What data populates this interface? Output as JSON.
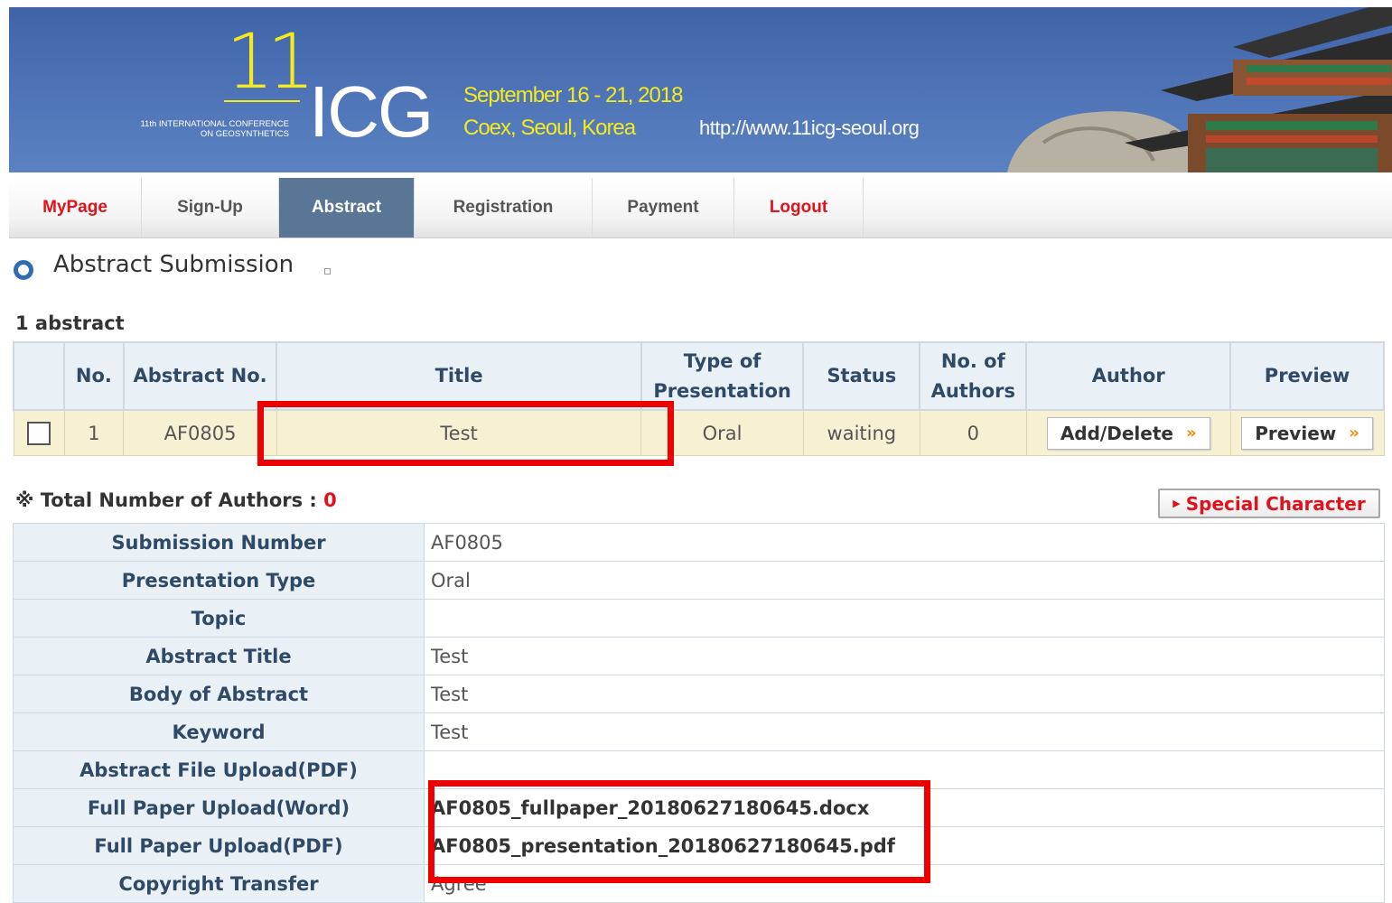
{
  "header": {
    "logo_number": "11",
    "logo_subtitle_line1": "11th INTERNATIONAL CONFERENCE",
    "logo_subtitle_line2": "ON GEOSYNTHETICS",
    "logo_acronym": "ICG",
    "event_date": "September 16 - 21, 2018",
    "event_venue": "Coex, Seoul, Korea",
    "event_url": "http://www.11icg-seoul.org"
  },
  "nav": {
    "items": [
      {
        "label": "MyPage"
      },
      {
        "label": "Sign-Up"
      },
      {
        "label": "Abstract"
      },
      {
        "label": "Registration"
      },
      {
        "label": "Payment"
      },
      {
        "label": "Logout"
      }
    ]
  },
  "page": {
    "title": "Abstract Submission",
    "count_label": "1 abstract"
  },
  "list": {
    "headers": {
      "no": "No.",
      "abstract_no": "Abstract No.",
      "title": "Title",
      "type_line1": "Type of",
      "type_line2": "Presentation",
      "status": "Status",
      "authors_line1": "No. of",
      "authors_line2": "Authors",
      "author": "Author",
      "preview": "Preview"
    },
    "rows": [
      {
        "no": "1",
        "abstract_no": "AF0805",
        "title": "Test",
        "type": "Oral",
        "status": "waiting",
        "authors": "0",
        "author_button": "Add/Delete",
        "preview_button": "Preview"
      }
    ],
    "button_chevron": "»"
  },
  "authors_total": {
    "label": "※ Total Number of Authors : ",
    "count": "0"
  },
  "special_character_button": "Special Character",
  "details": {
    "rows": [
      {
        "label": "Submission Number",
        "value": "AF0805"
      },
      {
        "label": "Presentation Type",
        "value": "Oral"
      },
      {
        "label": "Topic",
        "value": ""
      },
      {
        "label": "Abstract Title",
        "value": "Test"
      },
      {
        "label": "Body of Abstract",
        "value": "Test"
      },
      {
        "label": "Keyword",
        "value": "Test"
      },
      {
        "label": "Abstract File Upload(PDF)",
        "value": ""
      },
      {
        "label": "Full Paper Upload(Word)",
        "value": "AF0805_fullpaper_20180627180645.docx"
      },
      {
        "label": "Full Paper Upload(PDF)",
        "value": "AF0805_presentation_20180627180645.pdf"
      },
      {
        "label": "Copyright Transfer",
        "value": "Agree"
      }
    ]
  },
  "colors": {
    "banner": "#4c72b5",
    "nav_active": "#5a7696",
    "accent_red": "#e0121b",
    "highlight": "#ee0000",
    "row_bg": "#f6f1d2"
  }
}
